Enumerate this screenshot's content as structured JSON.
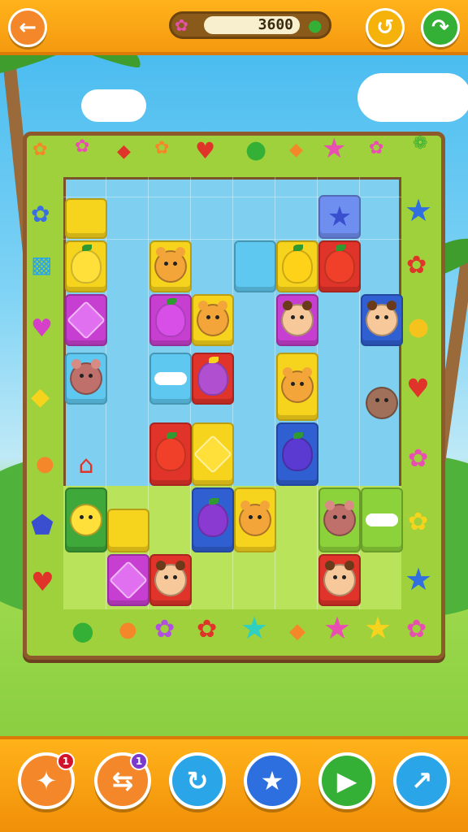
{
  "topbar": {
    "score": "3600",
    "back_icon": "arrow-left-icon",
    "undo_icon": "undo-icon",
    "share_icon": "share-icon"
  },
  "powerups": [
    {
      "icon": "magic-wand-icon",
      "badge": "1",
      "color": "#f4872a"
    },
    {
      "icon": "swap-icon",
      "badge": "1",
      "color": "#f4872a"
    },
    {
      "icon": "rotate-icon",
      "badge": "",
      "color": "#2aa6e8"
    },
    {
      "icon": "star-move-icon",
      "badge": "",
      "color": "#2e6fe0"
    },
    {
      "icon": "play-icon",
      "badge": "",
      "color": "#35b036"
    },
    {
      "icon": "arrow-up-right-icon",
      "badge": "",
      "color": "#2aa6e8"
    }
  ],
  "colors": {
    "orange_bar": "#f59a10",
    "board_green": "#9ed13b",
    "tile_yellow": "#f6d31c",
    "tile_purple": "#c73fd1",
    "tile_red": "#e0332a",
    "tile_blue": "#2f5fd0",
    "tile_sky": "#5fc8f0",
    "tile_green": "#8cd23a"
  }
}
